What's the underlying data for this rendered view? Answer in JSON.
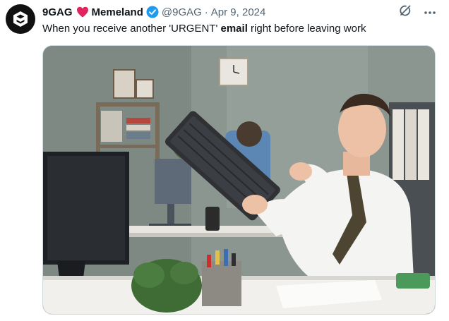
{
  "tweet": {
    "author_name": "9GAG",
    "collab_name": "Memeland",
    "handle": "@9GAG",
    "separator": "·",
    "date": "Apr 9, 2024",
    "text_part1": "When you receive another 'URGENT' ",
    "text_bold": "email",
    "text_part2": " right before leaving work"
  },
  "icons": {
    "avatar": "9gag-logo-icon",
    "heart": "red-heart-icon",
    "verified": "verified-badge-icon",
    "grok": "grok-icon",
    "more": "more-icon"
  },
  "colors": {
    "verified": "#1d9bf0",
    "heart": "#e0245e",
    "secondary_text": "#536471"
  }
}
